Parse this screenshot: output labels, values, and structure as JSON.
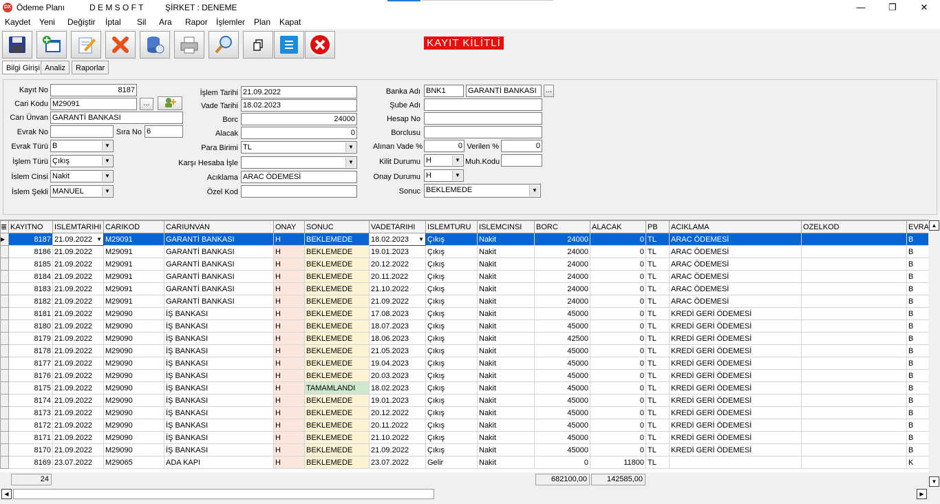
{
  "window": {
    "title": "Ödeme Planı",
    "company": "D E M S O F T",
    "sirket": "ŞİRKET : DENEME"
  },
  "menu": [
    "Kaydet",
    "Yeni",
    "Değiştir",
    "İptal",
    "Sil",
    "Ara",
    "Rapor",
    "İşlemler",
    "Plan",
    "Kapat"
  ],
  "toolbar": {
    "buttons": [
      "save-icon",
      "new-icon",
      "edit-icon",
      "delete-icon",
      "database-icon",
      "print-icon",
      "search-icon",
      "copy-icon",
      "list-icon",
      "close-icon"
    ],
    "lock_badge": "KAYIT KİLİTLİ"
  },
  "tabs": [
    "Bilgi Girişi",
    "Analiz",
    "Raporlar"
  ],
  "form": {
    "kayit_no": {
      "label": "Kayıt No",
      "value": "8187"
    },
    "cari_kodu": {
      "label": "Cari Kodu",
      "value": "M29091",
      "btn": "..."
    },
    "cari_unvan": {
      "label": "Carı Ünvan",
      "value": "GARANTİ BANKASI"
    },
    "evrak_no": {
      "label": "Evrak No",
      "value": ""
    },
    "sira_no": {
      "label": "Sıra No",
      "value": "6"
    },
    "evrak_turu": {
      "label": "Evrak Türü",
      "value": "B"
    },
    "islem_turu": {
      "label": "İşlem Türü",
      "value": "Çıkış"
    },
    "islem_cinsi": {
      "label": "İslem Cinsi",
      "value": "Nakit"
    },
    "islem_sekli": {
      "label": "İslem Şekli",
      "value": "MANUEL"
    },
    "islem_tarihi": {
      "label": "İşlem Tarihi",
      "value": "21.09.2022"
    },
    "vade_tarihi": {
      "label": "Vade Tarihi",
      "value": "18.02.2023"
    },
    "borc": {
      "label": "Borc",
      "value": "24000"
    },
    "alacak": {
      "label": "Alacak",
      "value": "0"
    },
    "para_birimi": {
      "label": "Para Birimi",
      "value": "TL"
    },
    "karsi_hesaba": {
      "label": "Karşı Hesaba İşle",
      "value": ""
    },
    "aciklama": {
      "label": "Acıklama",
      "value": "ARAC ÖDEMESİ"
    },
    "ozel_kod": {
      "label": "Özel Kod",
      "value": ""
    },
    "banka_adi": {
      "label": "Banka Adı",
      "code": "BNK1",
      "value": "GARANTİ BANKASI",
      "btn": "..."
    },
    "sube_adi": {
      "label": "Şube Adı",
      "value": ""
    },
    "hesap_no": {
      "label": "Hesap No",
      "value": ""
    },
    "borclusu": {
      "label": "Borclusu",
      "value": ""
    },
    "alinan_vade": {
      "label": "Alınan Vade %",
      "value": "0"
    },
    "verilen": {
      "label": "Verilen %",
      "value": "0"
    },
    "kilit_durumu": {
      "label": "Kilit Durumu",
      "value": "H"
    },
    "muh_kodu": {
      "label": "Muh.Kodu",
      "value": ""
    },
    "onay_durumu": {
      "label": "Onay Durumu",
      "value": "H"
    },
    "sonuc": {
      "label": "Sonuc",
      "value": "BEKLEMEDE"
    }
  },
  "grid": {
    "columns": [
      "KAYITNO",
      "ISLEMTARIHI",
      "CARIKOD",
      "CARIUNVAN",
      "ONAY",
      "SONUC",
      "VADETARIHI",
      "ISLEMTURU",
      "ISLEMCINSI",
      "BORC",
      "ALACAK",
      "PB",
      "ACIKLAMA",
      "OZELKOD",
      "EVRA"
    ],
    "rows": [
      [
        "8187",
        "21.09.2022",
        "M29091",
        "GARANTİ BANKASI",
        "H",
        "BEKLEMEDE",
        "18.02.2023",
        "Çıkış",
        "Nakit",
        "24000",
        "0",
        "TL",
        "ARAC ÖDEMESİ",
        "",
        "B"
      ],
      [
        "8186",
        "21.09.2022",
        "M29091",
        "GARANTİ BANKASI",
        "H",
        "BEKLEMEDE",
        "19.01.2023",
        "Çıkış",
        "Nakit",
        "24000",
        "0",
        "TL",
        "ARAC ÖDEMESİ",
        "",
        "B"
      ],
      [
        "8185",
        "21.09.2022",
        "M29091",
        "GARANTİ BANKASI",
        "H",
        "BEKLEMEDE",
        "20.12.2022",
        "Çıkış",
        "Nakit",
        "24000",
        "0",
        "TL",
        "ARAC ÖDEMESİ",
        "",
        "B"
      ],
      [
        "8184",
        "21.09.2022",
        "M29091",
        "GARANTİ BANKASI",
        "H",
        "BEKLEMEDE",
        "20.11.2022",
        "Çıkış",
        "Nakit",
        "24000",
        "0",
        "TL",
        "ARAC ÖDEMESİ",
        "",
        "B"
      ],
      [
        "8183",
        "21.09.2022",
        "M29091",
        "GARANTİ BANKASI",
        "H",
        "BEKLEMEDE",
        "21.10.2022",
        "Çıkış",
        "Nakit",
        "24000",
        "0",
        "TL",
        "ARAC ÖDEMESİ",
        "",
        "B"
      ],
      [
        "8182",
        "21.09.2022",
        "M29091",
        "GARANTİ BANKASI",
        "H",
        "BEKLEMEDE",
        "21.09.2022",
        "Çıkış",
        "Nakit",
        "24000",
        "0",
        "TL",
        "ARAC ÖDEMESİ",
        "",
        "B"
      ],
      [
        "8181",
        "21.09.2022",
        "M29090",
        "İŞ BANKASI",
        "H",
        "BEKLEMEDE",
        "17.08.2023",
        "Çıkış",
        "Nakit",
        "45000",
        "0",
        "TL",
        "KREDİ GERİ ÖDEMESİ",
        "",
        "B"
      ],
      [
        "8180",
        "21.09.2022",
        "M29090",
        "İŞ BANKASI",
        "H",
        "BEKLEMEDE",
        "18.07.2023",
        "Çıkış",
        "Nakit",
        "45000",
        "0",
        "TL",
        "KREDİ GERİ ÖDEMESİ",
        "",
        "B"
      ],
      [
        "8179",
        "21.09.2022",
        "M29090",
        "İŞ BANKASI",
        "H",
        "BEKLEMEDE",
        "18.06.2023",
        "Çıkış",
        "Nakit",
        "42500",
        "0",
        "TL",
        "KREDİ GERİ ÖDEMESİ",
        "",
        "B"
      ],
      [
        "8178",
        "21.09.2022",
        "M29090",
        "İŞ BANKASI",
        "H",
        "BEKLEMEDE",
        "21.05.2023",
        "Çıkış",
        "Nakit",
        "45000",
        "0",
        "TL",
        "KREDİ GERİ ÖDEMESİ",
        "",
        "B"
      ],
      [
        "8177",
        "21.09.2022",
        "M29090",
        "İŞ BANKASI",
        "H",
        "BEKLEMEDE",
        "19.04.2023",
        "Çıkış",
        "Nakit",
        "45000",
        "0",
        "TL",
        "KREDİ GERİ ÖDEMESİ",
        "",
        "B"
      ],
      [
        "8176",
        "21.09.2022",
        "M29090",
        "İŞ BANKASI",
        "H",
        "BEKLEMEDE",
        "20.03.2023",
        "Çıkış",
        "Nakit",
        "45000",
        "0",
        "TL",
        "KREDİ GERİ ÖDEMESİ",
        "",
        "B"
      ],
      [
        "8175",
        "21.09.2022",
        "M29090",
        "İŞ BANKASI",
        "H",
        "TAMAMLANDI",
        "18.02.2023",
        "Çıkış",
        "Nakit",
        "45000",
        "0",
        "TL",
        "KREDİ GERİ ÖDEMESİ",
        "",
        "B"
      ],
      [
        "8174",
        "21.09.2022",
        "M29090",
        "İŞ BANKASI",
        "H",
        "BEKLEMEDE",
        "19.01.2023",
        "Çıkış",
        "Nakit",
        "45000",
        "0",
        "TL",
        "KREDİ GERİ ÖDEMESİ",
        "",
        "B"
      ],
      [
        "8173",
        "21.09.2022",
        "M29090",
        "İŞ BANKASI",
        "H",
        "BEKLEMEDE",
        "20.12.2022",
        "Çıkış",
        "Nakit",
        "45000",
        "0",
        "TL",
        "KREDİ GERİ ÖDEMESİ",
        "",
        "B"
      ],
      [
        "8172",
        "21.09.2022",
        "M29090",
        "İŞ BANKASI",
        "H",
        "BEKLEMEDE",
        "20.11.2022",
        "Çıkış",
        "Nakit",
        "45000",
        "0",
        "TL",
        "KREDİ GERİ ÖDEMESİ",
        "",
        "B"
      ],
      [
        "8171",
        "21.09.2022",
        "M29090",
        "İŞ BANKASI",
        "H",
        "BEKLEMEDE",
        "21.10.2022",
        "Çıkış",
        "Nakit",
        "45000",
        "0",
        "TL",
        "KREDİ GERİ ÖDEMESİ",
        "",
        "B"
      ],
      [
        "8170",
        "21.09.2022",
        "M29090",
        "İŞ BANKASI",
        "H",
        "BEKLEMEDE",
        "21.09.2022",
        "Çıkış",
        "Nakit",
        "45000",
        "0",
        "TL",
        "KREDİ GERİ ÖDEMESİ",
        "",
        "B"
      ],
      [
        "8169",
        "23.07.2022",
        "M29065",
        "ADA KAPI",
        "H",
        "BEKLEMEDE",
        "23.07.2022",
        "Gelir",
        "Nakit",
        "0",
        "11800",
        "TL",
        "",
        "",
        "K"
      ]
    ],
    "footer": {
      "count": "24",
      "borc_total": "682100,00",
      "alacak_total": "142585,00"
    }
  },
  "colors": {
    "selection": "#0a64d0",
    "onay_bg": "#fbe6de",
    "sonuc_bg": "#fbf3d4",
    "done_bg": "#cfe9cf",
    "lock_badge": "#e8100c"
  }
}
